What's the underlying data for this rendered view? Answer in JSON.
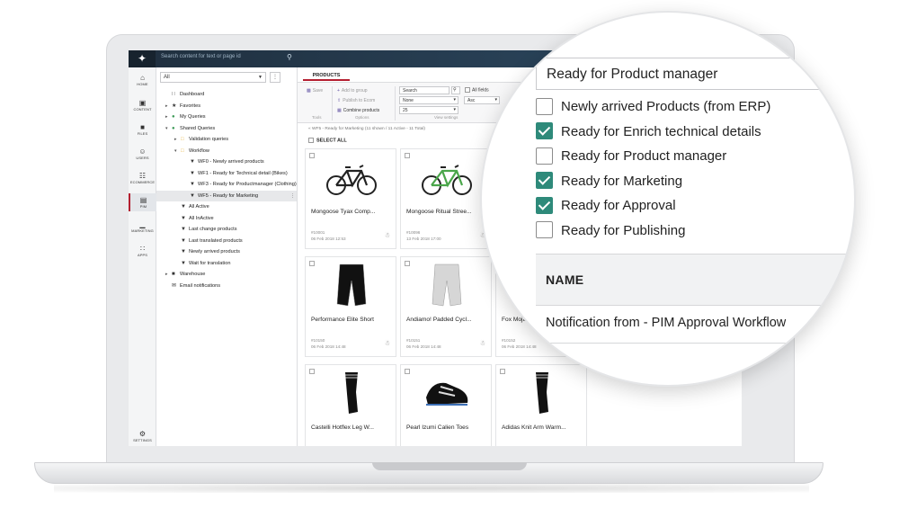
{
  "topbar": {
    "logo": "✦",
    "search_placeholder": "Search content for text or page id",
    "search_icon": "search-icon"
  },
  "leftnav": {
    "items": [
      {
        "icon": "⌂",
        "label": "HOME"
      },
      {
        "icon": "▣",
        "label": "CONTENT"
      },
      {
        "icon": "■",
        "label": "FILES"
      },
      {
        "icon": "☺",
        "label": "USERS"
      },
      {
        "icon": "☷",
        "label": "ECOMMERCE"
      },
      {
        "icon": "▤",
        "label": "PIM"
      },
      {
        "icon": "▁",
        "label": "MARKETING"
      },
      {
        "icon": "∷",
        "label": "APPS"
      },
      {
        "icon": "⚙",
        "label": "SETTINGS"
      }
    ]
  },
  "tree": {
    "select_value": "All",
    "option_icon": "⋮",
    "rows": [
      {
        "label": "Dashboard",
        "icon": "∷",
        "toggle": ""
      },
      {
        "label": "Favorites",
        "icon": "★",
        "toggle": "▸"
      },
      {
        "label": "My Queries",
        "icon": "●",
        "toggle": "▸"
      },
      {
        "label": "Shared Queries",
        "icon": "●",
        "toggle": "▾"
      },
      {
        "label": "Validation queries",
        "icon": "□",
        "toggle": "▸"
      },
      {
        "label": "Workflow",
        "icon": "□",
        "toggle": "▾"
      },
      {
        "label": "WF0 - Newly arrived products",
        "icon": "▼",
        "toggle": ""
      },
      {
        "label": "WF1 - Ready for Technical detail (Bikes)",
        "icon": "▼",
        "toggle": ""
      },
      {
        "label": "WF3 - Ready for Productmanager (Clothing)",
        "icon": "▼",
        "toggle": ""
      },
      {
        "label": "WF5 - Ready for Marketing",
        "icon": "▼",
        "toggle": "",
        "count": "⋮"
      },
      {
        "label": "All Active",
        "icon": "▼",
        "toggle": ""
      },
      {
        "label": "All InActive",
        "icon": "▼",
        "toggle": ""
      },
      {
        "label": "Last change products",
        "icon": "▼",
        "toggle": ""
      },
      {
        "label": "Last translated products",
        "icon": "▼",
        "toggle": ""
      },
      {
        "label": "Newly arrived products",
        "icon": "▼",
        "toggle": ""
      },
      {
        "label": "Wait for translation",
        "icon": "▼",
        "toggle": ""
      },
      {
        "label": "Warehouse",
        "icon": "■",
        "toggle": "▸"
      },
      {
        "label": "Email notifications",
        "icon": "✉",
        "toggle": ""
      }
    ]
  },
  "content": {
    "tab": "PRODUCTS",
    "toolbar": {
      "save": "Save",
      "add_to_group": "Add to group",
      "publish_to_ecom": "Publish to Ecom",
      "combine_products": "Combine products",
      "group_tools": "Tools",
      "group_options": "Options",
      "search_placeholder": "Search",
      "all_fields": "All fields",
      "sort_none": "None",
      "sort_dir": "Asc",
      "page_size": "25",
      "group_view": "View settings"
    },
    "breadcrumb": "« WF5 - Ready for Marketing (11 shown / 11 Active - 11 Total)",
    "select_all": "SELECT ALL",
    "products": [
      {
        "name": "Mongoose Tyax Comp...",
        "id": "#10001",
        "date": "06 Feb 2018 12:53",
        "img": "bike",
        "color": "#222"
      },
      {
        "name": "Mongoose Ritual Stree...",
        "id": "#10096",
        "date": "13 Feb 2018 17:00",
        "img": "bike",
        "color": "#4aa64a"
      },
      {
        "name": "Performance Elite Short",
        "id": "#10150",
        "date": "06 Feb 2018 14:48",
        "img": "shorts",
        "color": "#111"
      },
      {
        "name": "Andiamo! Padded Cycl...",
        "id": "#10151",
        "date": "06 Feb 2018 14:48",
        "img": "shorts",
        "color": "#d6d6d6"
      },
      {
        "name": "Fox Mojave...",
        "id": "#10152",
        "date": "06 Feb 2018 14:48",
        "img": "",
        "color": "#111"
      },
      {
        "name": "Castelli Hotflex Leg W...",
        "id": "",
        "date": "",
        "img": "sleeve",
        "color": "#111"
      },
      {
        "name": "Pearl Izumi Calien Toes",
        "id": "",
        "date": "",
        "img": "shoe",
        "color": "#111"
      },
      {
        "name": "Adidas Knit Arm Warm...",
        "id": "",
        "date": "",
        "img": "sleeve",
        "color": "#111"
      }
    ]
  },
  "magnifier": {
    "select_value": "Ready for Product manager",
    "options": [
      {
        "label": "Newly arrived Products (from ERP)",
        "checked": false
      },
      {
        "label": "Ready for Enrich technical details",
        "checked": true
      },
      {
        "label": "Ready for Product manager",
        "checked": false
      },
      {
        "label": "Ready for Marketing",
        "checked": true
      },
      {
        "label": "Ready for Approval",
        "checked": true
      },
      {
        "label": "Ready for Publishing",
        "checked": false
      }
    ],
    "table_header": "NAME",
    "table_row": "Notification from - PIM Approval Workflow",
    "check_color": "#2e8a7a"
  }
}
